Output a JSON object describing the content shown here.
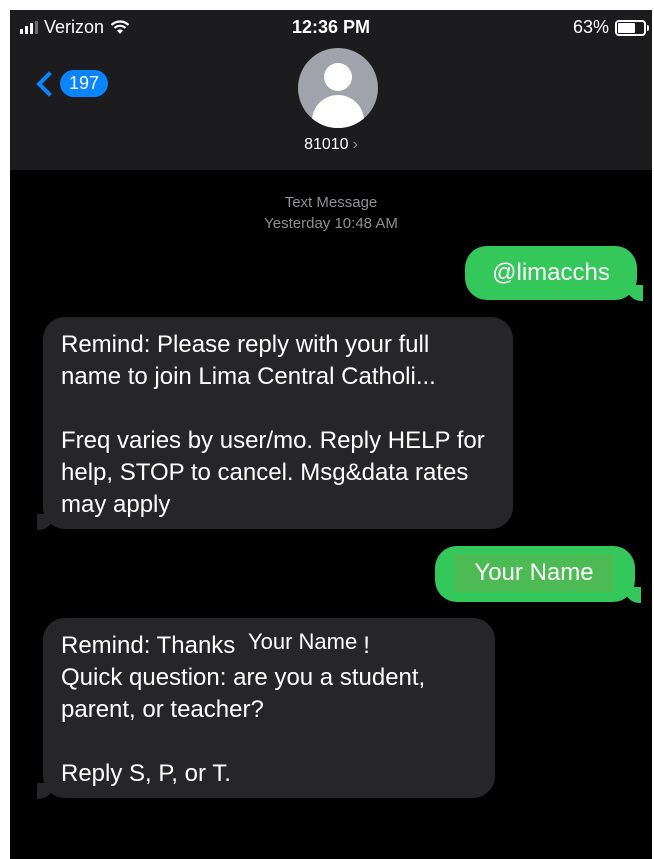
{
  "status_bar": {
    "carrier": "Verizon",
    "time": "12:36 PM",
    "battery": "63%",
    "battery_level": 0.63
  },
  "nav": {
    "back_count": "197",
    "contact_name": "81010",
    "contact_chevron": "›"
  },
  "thread": {
    "stamp_type": "Text Message",
    "stamp_time": "Yesterday 10:48 AM",
    "messages": [
      {
        "dir": "out",
        "text": "@limacchs"
      },
      {
        "dir": "in",
        "line1": "Remind: Please reply with your full name to join Lima Central Catholi...",
        "line2": "Freq varies by user/mo. Reply HELP for help, STOP to cancel. Msg&data rates may apply"
      },
      {
        "dir": "out",
        "text": "Your Name"
      },
      {
        "dir": "in",
        "prefix": "Remind: Thanks",
        "name": "Your Name",
        "suffix": "!",
        "line1": "Quick question: are you a student, parent, or teacher?",
        "line2": "Reply S, P, or T."
      }
    ]
  }
}
